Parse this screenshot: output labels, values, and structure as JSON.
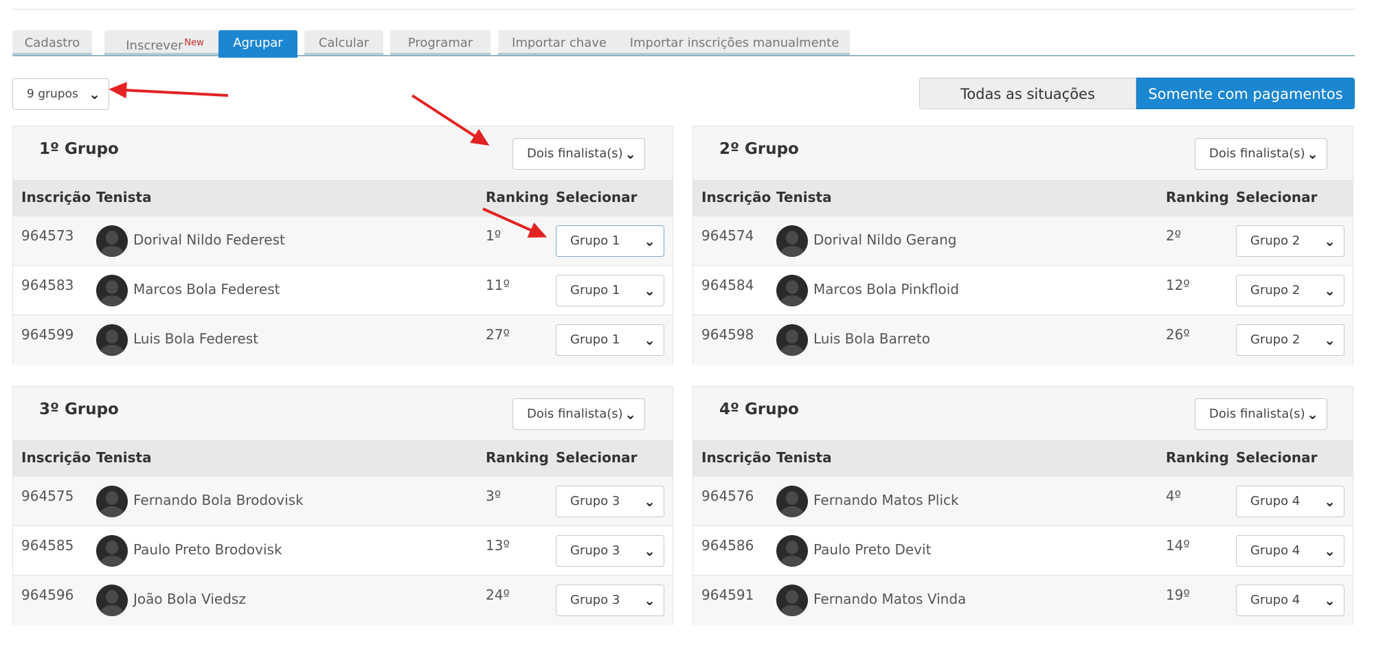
{
  "tabs": [
    {
      "label": "Cadastro",
      "badge": ""
    },
    {
      "label": "Inscrever",
      "badge": "New"
    },
    {
      "label": "Agrupar",
      "badge": ""
    },
    {
      "label": "Calcular",
      "badge": ""
    },
    {
      "label": "Programar",
      "badge": ""
    },
    {
      "label": "Importar chave",
      "badge": ""
    },
    {
      "label": "Importar inscrições manualmente",
      "badge": ""
    }
  ],
  "active_tab": "Agrupar",
  "group_count_select": "9 grupos",
  "status_filter": {
    "all_label": "Todas as situações",
    "paid_label": "Somente com pagamentos",
    "selected": "Somente com pagamentos"
  },
  "table_headers": {
    "inscricao": "Inscrição",
    "tenista": "Tenista",
    "ranking": "Ranking",
    "selecionar": "Selecionar"
  },
  "groups": [
    {
      "title": "1º Grupo",
      "finalists": "Dois finalista(s)",
      "rows": [
        {
          "inscricao": "964573",
          "tenista": "Dorival Nildo Federest",
          "ranking": "1º",
          "grupo": "Grupo 1"
        },
        {
          "inscricao": "964583",
          "tenista": "Marcos Bola Federest",
          "ranking": "11º",
          "grupo": "Grupo 1"
        },
        {
          "inscricao": "964599",
          "tenista": "Luis Bola Federest",
          "ranking": "27º",
          "grupo": "Grupo 1"
        }
      ]
    },
    {
      "title": "2º Grupo",
      "finalists": "Dois finalista(s)",
      "rows": [
        {
          "inscricao": "964574",
          "tenista": "Dorival Nildo Gerang",
          "ranking": "2º",
          "grupo": "Grupo 2"
        },
        {
          "inscricao": "964584",
          "tenista": "Marcos Bola Pinkfloid",
          "ranking": "12º",
          "grupo": "Grupo 2"
        },
        {
          "inscricao": "964598",
          "tenista": "Luis Bola Barreto",
          "ranking": "26º",
          "grupo": "Grupo 2"
        }
      ]
    },
    {
      "title": "3º Grupo",
      "finalists": "Dois finalista(s)",
      "rows": [
        {
          "inscricao": "964575",
          "tenista": "Fernando Bola Brodovisk",
          "ranking": "3º",
          "grupo": "Grupo 3"
        },
        {
          "inscricao": "964585",
          "tenista": "Paulo Preto Brodovisk",
          "ranking": "13º",
          "grupo": "Grupo 3"
        },
        {
          "inscricao": "964596",
          "tenista": "João Bola Viedsz",
          "ranking": "24º",
          "grupo": "Grupo 3"
        }
      ]
    },
    {
      "title": "4º Grupo",
      "finalists": "Dois finalista(s)",
      "rows": [
        {
          "inscricao": "964576",
          "tenista": "Fernando Matos Plick",
          "ranking": "4º",
          "grupo": "Grupo 4"
        },
        {
          "inscricao": "964586",
          "tenista": "Paulo Preto Devit",
          "ranking": "14º",
          "grupo": "Grupo 4"
        },
        {
          "inscricao": "964591",
          "tenista": "Fernando Matos Vinda",
          "ranking": "19º",
          "grupo": "Grupo 4"
        }
      ]
    }
  ],
  "colors": {
    "accent": "#1b86d1",
    "annotation": "#e32222",
    "new_badge": "#c62828"
  }
}
